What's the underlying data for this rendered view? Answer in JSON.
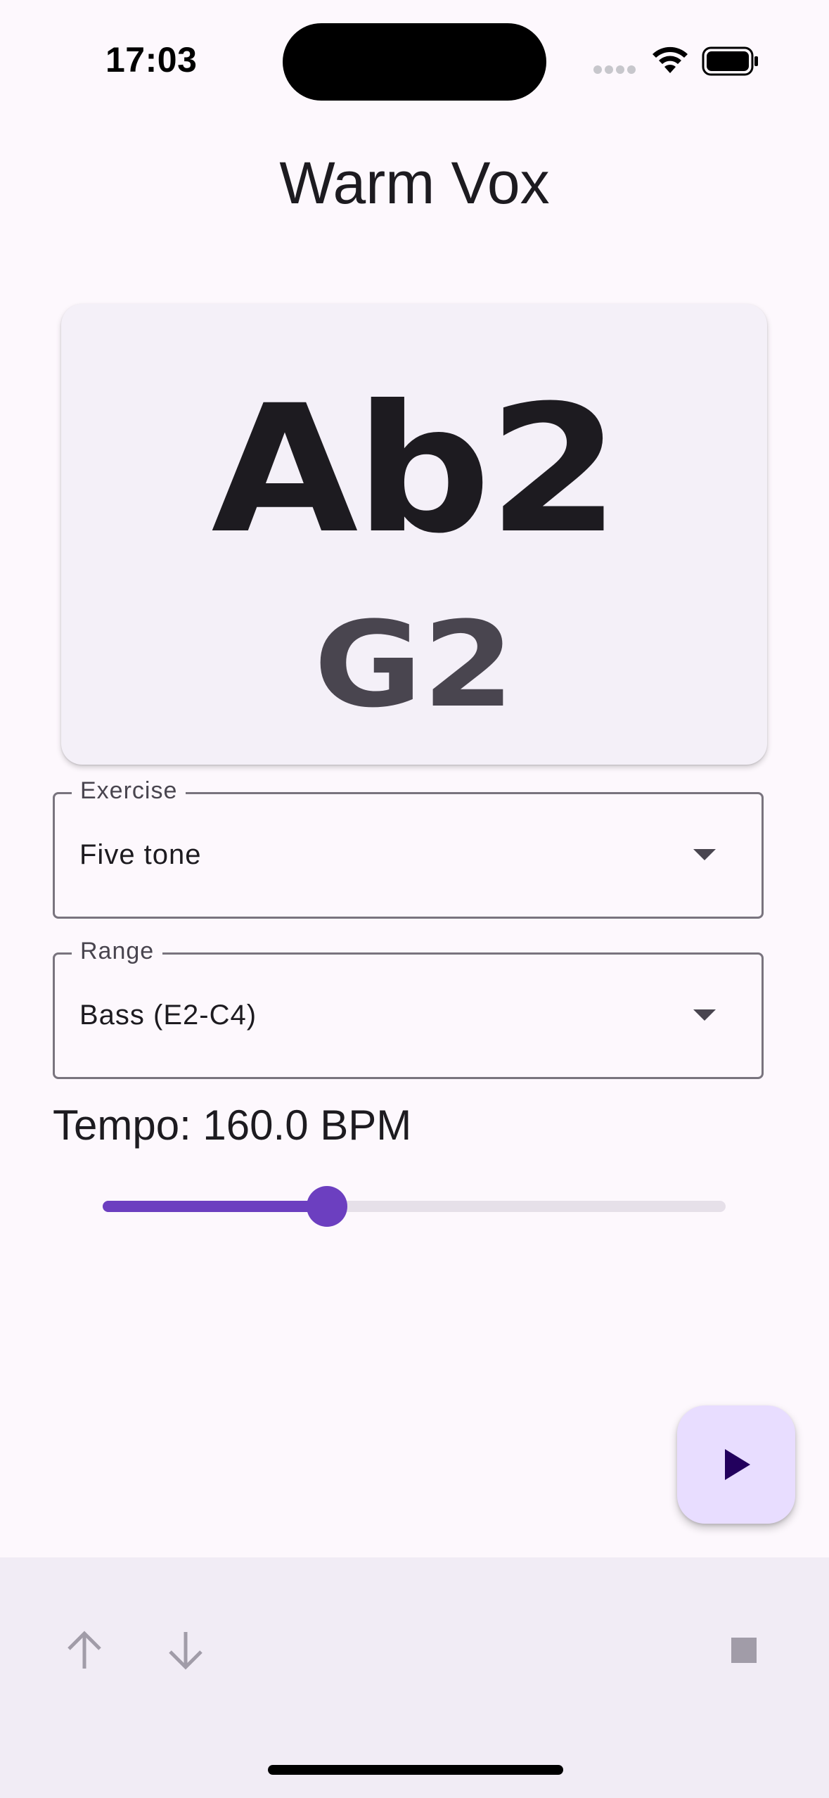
{
  "status_bar": {
    "time": "17:03",
    "icons": [
      "signal-icon",
      "wifi-icon",
      "battery-icon"
    ]
  },
  "app": {
    "title": "Warm Vox"
  },
  "note_card": {
    "current_note": "Ab2",
    "next_note": "G2"
  },
  "exercise_field": {
    "label": "Exercise",
    "value": "Five tone"
  },
  "range_field": {
    "label": "Range",
    "value": "Bass (E2-C4)"
  },
  "tempo": {
    "label": "Tempo: 160.0 BPM",
    "slider_fraction": 0.36
  },
  "fab": {
    "icon": "play-icon"
  },
  "bottom_bar": {
    "buttons": [
      "arrow-up-icon",
      "arrow-down-icon",
      "stop-icon"
    ]
  },
  "colors": {
    "accent": "#6c3fc0",
    "fab_bg": "#e8ddff",
    "card_bg": "#f4f0f8",
    "bottom_bar_bg": "#f1ecf5",
    "disabled_icon": "#a19ca8"
  }
}
